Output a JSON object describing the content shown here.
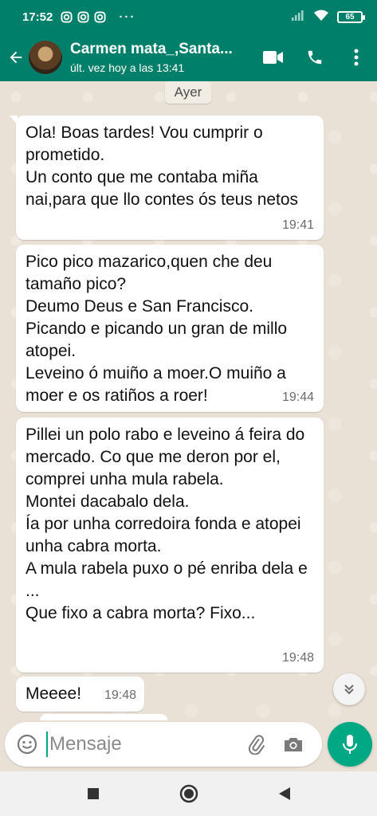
{
  "status_bar": {
    "time": "17:52",
    "dots": "···",
    "battery": "65"
  },
  "header": {
    "contact_name": "Carmen mata_,Santa...",
    "last_seen": "últ. vez hoy a las 13:41"
  },
  "chat": {
    "date_label": "Ayer",
    "messages": [
      {
        "text": "Ola! Boas tardes! Vou cumprir o prometido.\nUn conto que me contaba miña nai,para que llo contes ós teus netos",
        "time": "19:41"
      },
      {
        "text": "Pico pico mazarico,quen che deu tamaño pico?\nDeumo Deus e San Francisco.\nPicando e picando un gran de millo atopei.\nLeveino ó muiño a moer.O muiño a moer e os ratiños a roer!",
        "time": "19:44"
      },
      {
        "text": "Pillei un polo rabo e leveino á feira do mercado. Co que me deron por el, comprei unha mula rabela.\nMontei dacabalo dela.\nÍa por unha corredoira fonda e atopei unha cabra morta.\nA mula rabela puxo o pé enriba dela e ...\nQue fixo a cabra morta? Fixo...",
        "time": "19:48"
      },
      {
        "text": "Meeee!",
        "time": "19:48"
      }
    ]
  },
  "input": {
    "placeholder": "Mensaje"
  },
  "colors": {
    "header": "#00806a",
    "accent": "#00a884",
    "chat_bg": "#e9e1d6",
    "bubble": "#ffffff"
  },
  "icons": {
    "back": "arrow-left",
    "video": "video-camera",
    "call": "phone",
    "menu": "more-vertical",
    "emoji": "smiley",
    "attach": "paperclip",
    "camera": "camera",
    "mic": "microphone",
    "scroll": "double-chevron-down"
  }
}
